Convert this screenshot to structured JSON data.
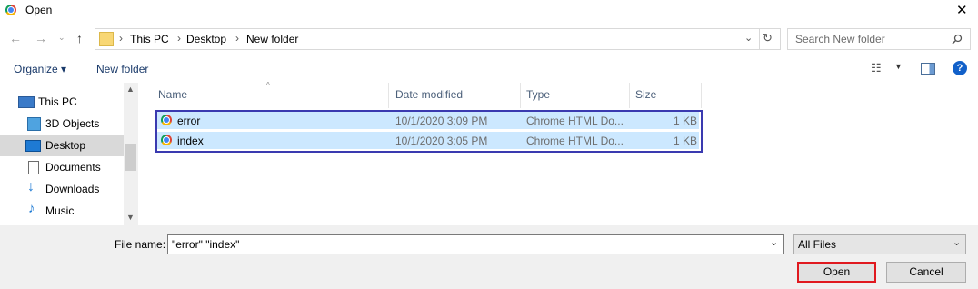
{
  "window": {
    "title": "Open",
    "close_glyph": "✕"
  },
  "address": {
    "breadcrumbs": [
      "This PC",
      "Desktop",
      "New folder"
    ],
    "search_placeholder": "Search New folder"
  },
  "toolbar": {
    "organize_label": "Organize ▾",
    "new_folder_label": "New folder"
  },
  "nav": {
    "items": [
      {
        "label": "This PC",
        "icon": "computer-icon",
        "selected": false
      },
      {
        "label": "3D Objects",
        "icon": "cube-icon",
        "selected": false
      },
      {
        "label": "Desktop",
        "icon": "desktop-icon",
        "selected": true
      },
      {
        "label": "Documents",
        "icon": "document-icon",
        "selected": false
      },
      {
        "label": "Downloads",
        "icon": "download-icon",
        "selected": false
      },
      {
        "label": "Music",
        "icon": "music-icon",
        "selected": false
      }
    ]
  },
  "list": {
    "columns": [
      "Name",
      "Date modified",
      "Type",
      "Size"
    ],
    "rows": [
      {
        "name": "error",
        "date": "10/1/2020 3:09 PM",
        "type": "Chrome HTML Do...",
        "size": "1 KB"
      },
      {
        "name": "index",
        "date": "10/1/2020 3:05 PM",
        "type": "Chrome HTML Do...",
        "size": "1 KB"
      }
    ]
  },
  "bottom": {
    "filename_label": "File name:",
    "filename_value": "\"error\" \"index\"",
    "filter_value": "All Files",
    "open_label": "Open",
    "cancel_label": "Cancel"
  },
  "colors": {
    "selection": "#cce8ff",
    "highlight_box": "#3a3ab0",
    "open_outline": "#e0191f",
    "help": "#1160c9"
  }
}
